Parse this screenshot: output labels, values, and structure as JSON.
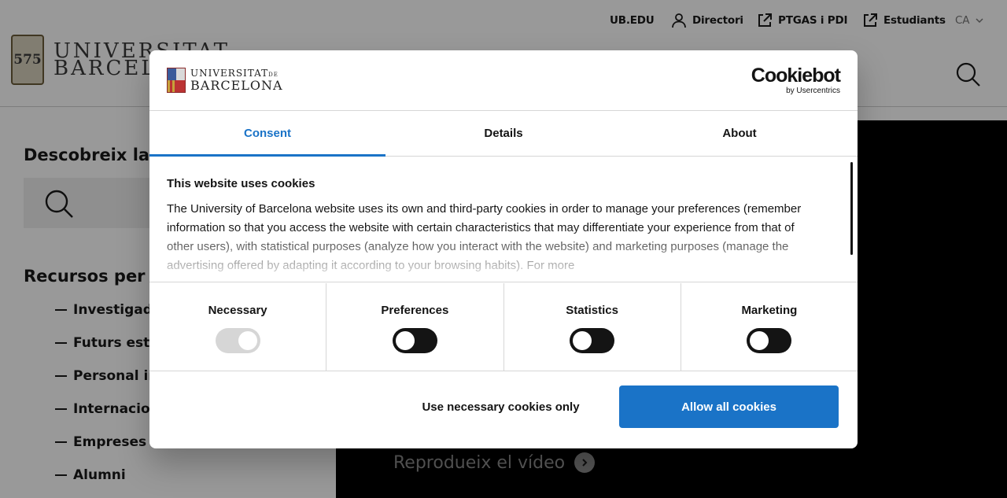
{
  "topbar": {
    "links": [
      {
        "label": "UB.EDU",
        "icon": ""
      },
      {
        "label": "Directori",
        "icon": "user-icon"
      },
      {
        "label": "PTGAS i PDI",
        "icon": "external-link-icon"
      },
      {
        "label": "Estudiants",
        "icon": "external-link-icon"
      }
    ],
    "language": "CA"
  },
  "header": {
    "logo_seal": "575",
    "logo_line1": "UNIVERSITAT",
    "logo_line2": "BARCELONA"
  },
  "sidebar": {
    "discover_title": "Descobreix la UB",
    "resources_title": "Recursos per a:",
    "resources": [
      "Investigadors",
      "Futurs estudiants",
      "Personal investigador",
      "Internacional",
      "Empreses",
      "Alumni"
    ]
  },
  "video": {
    "cta": "Reprodueix el vídeo"
  },
  "cookie_dialog": {
    "brand_line1": "UNIVERSITAT",
    "brand_line1_suffix": "DE",
    "brand_line2": "BARCELONA",
    "provider": "Cookiebot",
    "provider_sub": "by Usercentrics",
    "tabs": [
      "Consent",
      "Details",
      "About"
    ],
    "active_tab": "Consent",
    "title": "This website uses cookies",
    "text": "The University of Barcelona website uses its own and third-party cookies in order to manage your preferences (remember information so that you access the website with certain characteristics that may differentiate your experience from that of other users), with statistical purposes (analyze how you interact with the website) and marketing purposes (manage the advertising offered by adapting it according to your browsing habits). For more",
    "categories": [
      {
        "label": "Necessary",
        "state": "on",
        "disabled": true
      },
      {
        "label": "Preferences",
        "state": "off",
        "disabled": false
      },
      {
        "label": "Statistics",
        "state": "off",
        "disabled": false
      },
      {
        "label": "Marketing",
        "state": "off",
        "disabled": false
      }
    ],
    "buttons": {
      "necessary_only": "Use necessary cookies only",
      "allow_all": "Allow all cookies"
    },
    "colors": {
      "accent": "#1a73c7",
      "toggle_off": "#141414",
      "toggle_disabled": "#d6d6d6"
    }
  }
}
